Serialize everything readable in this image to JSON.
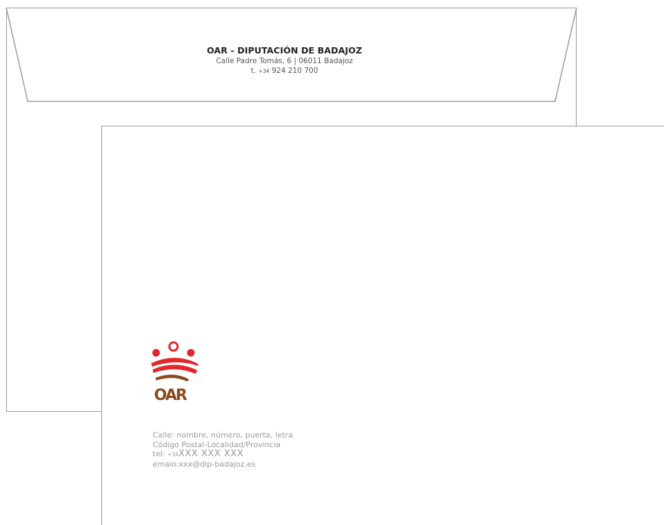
{
  "envelope": {
    "sender": {
      "name": "OAR - DIPUTACIÓN DE BADAJOZ",
      "address": "Calle Padre Tomás, 6 | 06011 Badajoz",
      "phone_label": "t.",
      "phone_prefix": "+34",
      "phone_number": "924 210 700"
    }
  },
  "letter": {
    "logo": {
      "text": "OAR",
      "colors": {
        "red": "#e3262b",
        "brown": "#8a4a1c"
      }
    },
    "address": {
      "line1": "Calle: nombre, número, puerta, letra",
      "line2": "Código Postal-Localidad/Provincia",
      "tel_label": "tel:",
      "tel_prefix": "+34",
      "tel_number": "XXX XXX XXX",
      "email": "emaio:xxx@dip-badajoz.es"
    }
  },
  "colors": {
    "outline": "#9a9a9a",
    "text_dark": "#1f1f1f",
    "text_grey": "#9a9a9a"
  }
}
